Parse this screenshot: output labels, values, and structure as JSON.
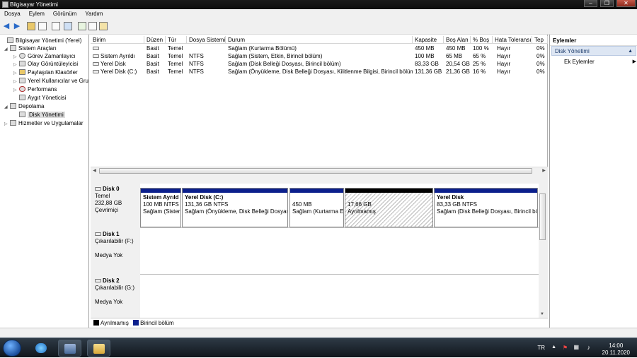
{
  "window": {
    "title": "Bilgisayar Yönetimi"
  },
  "menu": [
    "Dosya",
    "Eylem",
    "Görünüm",
    "Yardım"
  ],
  "tree": [
    {
      "label": "Bilgisayar Yönetimi (Yerel)",
      "indent": 0,
      "expander": "",
      "icon": "computer-icon"
    },
    {
      "label": "Sistem Araçları",
      "indent": 1,
      "expander": "◢",
      "icon": "tools-icon"
    },
    {
      "label": "Görev Zamanlayıcı",
      "indent": 2,
      "expander": "▷",
      "icon": "clock-icon"
    },
    {
      "label": "Olay Görüntüleyicisi",
      "indent": 2,
      "expander": "▷",
      "icon": "event-icon"
    },
    {
      "label": "Paylaşılan Klasörler",
      "indent": 2,
      "expander": "▷",
      "icon": "folder-icon"
    },
    {
      "label": "Yerel Kullanıcılar ve Gru",
      "indent": 2,
      "expander": "▷",
      "icon": "users-icon"
    },
    {
      "label": "Performans",
      "indent": 2,
      "expander": "▷",
      "icon": "performance-icon"
    },
    {
      "label": "Aygıt Yöneticisi",
      "indent": 2,
      "expander": "",
      "icon": "device-icon"
    },
    {
      "label": "Depolama",
      "indent": 1,
      "expander": "◢",
      "icon": "storage-icon"
    },
    {
      "label": "Disk Yönetimi",
      "indent": 2,
      "expander": "",
      "icon": "disk-icon",
      "selected": true
    },
    {
      "label": "Hizmetler ve Uygulamalar",
      "indent": 1,
      "expander": "▷",
      "icon": "services-icon"
    }
  ],
  "volume_table": {
    "headers": [
      "Birim",
      "Düzen",
      "Tür",
      "Dosya Sistemi",
      "Durum",
      "Kapasite",
      "Boş Alan",
      "% Boş",
      "Hata Toleransı",
      "Tep"
    ],
    "rows": [
      [
        "",
        "Basit",
        "Temel",
        "",
        "Sağlam (Kurtarma Bölümü)",
        "450 MB",
        "450 MB",
        "100 %",
        "Hayır",
        "0%"
      ],
      [
        "Sistem Ayrıldı",
        "Basit",
        "Temel",
        "NTFS",
        "Sağlam (Sistem, Etkin, Birincil bölüm)",
        "100 MB",
        "65 MB",
        "65 %",
        "Hayır",
        "0%"
      ],
      [
        "Yerel Disk",
        "Basit",
        "Temel",
        "NTFS",
        "Sağlam (Disk Belleği Dosyası, Birincil bölüm)",
        "83,33 GB",
        "20,54 GB",
        "25 %",
        "Hayır",
        "0%"
      ],
      [
        "Yerel Disk (C:)",
        "Basit",
        "Temel",
        "NTFS",
        "Sağlam (Önyükleme, Disk Belleği Dosyası, Kilitlenme Bilgisi, Birincil bölüm)",
        "131,36 GB",
        "21,36 GB",
        "16 %",
        "Hayır",
        "0%"
      ]
    ]
  },
  "disks": [
    {
      "name": "Disk 0",
      "line1": "Temel",
      "line2": "232,88 GB",
      "line3": "Çevrimiçi"
    },
    {
      "name": "Disk 1",
      "line1": "Çıkarılabilir (F:)",
      "line2": "",
      "line3": "Medya Yok"
    },
    {
      "name": "Disk 2",
      "line1": "Çıkarılabilir (G:)",
      "line2": "",
      "line3": "Medya Yok"
    }
  ],
  "partitions": [
    {
      "title": "Sistem Ayrıld",
      "size": "100 MB NTFS",
      "status": "Sağlam (Sister",
      "type": "primary"
    },
    {
      "title": "Yerel Disk (C:)",
      "size": "131,36 GB NTFS",
      "status": "Sağlam (Önyükleme, Disk Belleği Dosyas",
      "type": "primary"
    },
    {
      "title": "",
      "size": "450 MB",
      "status": "Sağlam (Kurtarma E",
      "type": "primary"
    },
    {
      "title": "",
      "size": "17,66 GB",
      "status": "Ayrılmamış",
      "type": "unallocated"
    },
    {
      "title": "Yerel Disk",
      "size": "83,33 GB NTFS",
      "status": "Sağlam (Disk Belleği Dosyası, Birincil bö",
      "type": "primary"
    }
  ],
  "legend": [
    {
      "label": "Ayrılmamış",
      "color": "#000000"
    },
    {
      "label": "Birincil bölüm",
      "color": "#0b1f8c"
    }
  ],
  "actions": {
    "header": "Eylemler",
    "selected": "Disk Yönetimi",
    "sub": "Ek Eylemler"
  },
  "tray": {
    "lang": "TR",
    "time": "14:00",
    "date": "20.11.2020"
  }
}
